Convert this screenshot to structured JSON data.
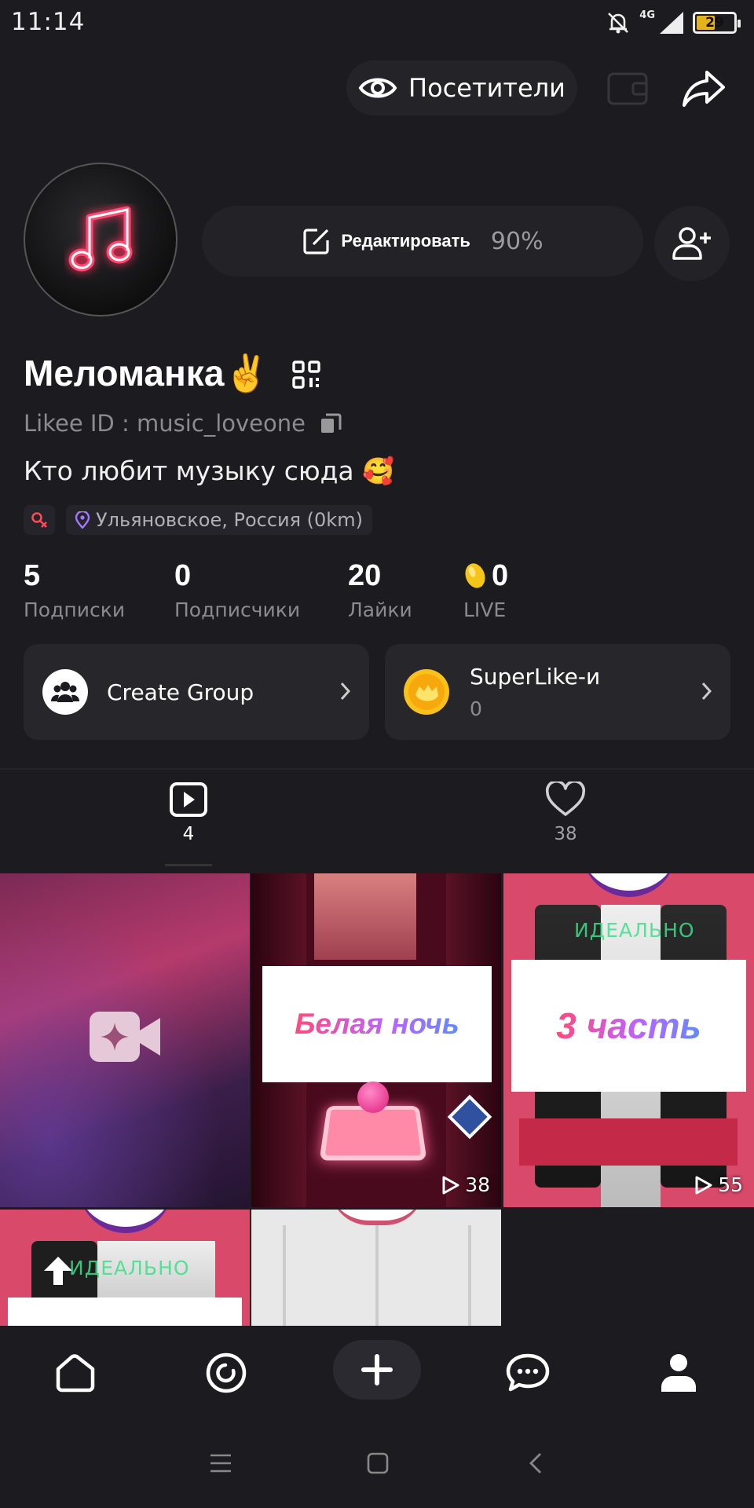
{
  "status_bar": {
    "time": "11:14",
    "network": "4G",
    "battery": "29",
    "icons": [
      "bell-muted-icon",
      "signal-icon",
      "battery-icon"
    ]
  },
  "top_bar": {
    "visitors_label": "Посетители",
    "icons": [
      "eye-icon",
      "wallet-icon",
      "share-icon"
    ]
  },
  "profile": {
    "edit_label": "Редактировать",
    "edit_percent": "90%",
    "name": "Меломанка✌️",
    "likee_id": "Likee ID : music_loveone",
    "bio": "Кто любит музыку сюда 🥰",
    "location": "Ульяновское, Россия (0km)"
  },
  "stats": [
    {
      "value": "5",
      "label": "Подписки"
    },
    {
      "value": "0",
      "label": "Подписчики"
    },
    {
      "value": "20",
      "label": "Лайки"
    },
    {
      "value": "0",
      "label": "LIVE"
    }
  ],
  "cards": {
    "group_label": "Create Group",
    "superlike_label": "SuperLike-и",
    "superlike_count": "0"
  },
  "tabs": {
    "videos_count": "4",
    "likes_count": "38"
  },
  "grid": {
    "tile2_caption": "Белая ночь",
    "tile2_views": "38",
    "tile3_caption": "3 часть",
    "tile3_views": "55",
    "perfect_text": "ИДЕАЛЬНО"
  },
  "colors": {
    "background": "#1c1b1f",
    "card": "#27262b",
    "accent_pink": "#e8497a",
    "gold": "#f5c518"
  }
}
